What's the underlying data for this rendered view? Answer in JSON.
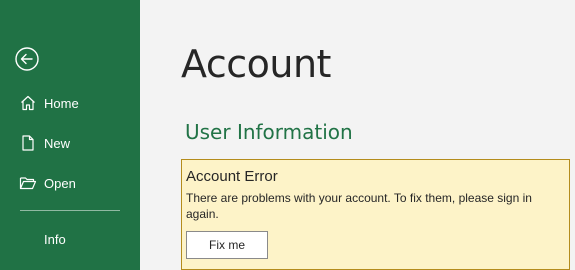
{
  "sidebar": {
    "back_icon": "back-arrow-icon",
    "items": [
      {
        "label": "Home",
        "icon": "home-icon"
      },
      {
        "label": "New",
        "icon": "new-document-icon"
      },
      {
        "label": "Open",
        "icon": "open-folder-icon"
      },
      {
        "label": "Info",
        "icon": ""
      }
    ],
    "background_color": "#207245"
  },
  "main": {
    "title": "Account",
    "section_title": "User Information",
    "error": {
      "title": "Account Error",
      "message": "There are problems with your account. To fix them, please sign in again.",
      "button_label": "Fix me",
      "background_color": "#fdf3c8",
      "border_color": "#b48c1c"
    }
  }
}
